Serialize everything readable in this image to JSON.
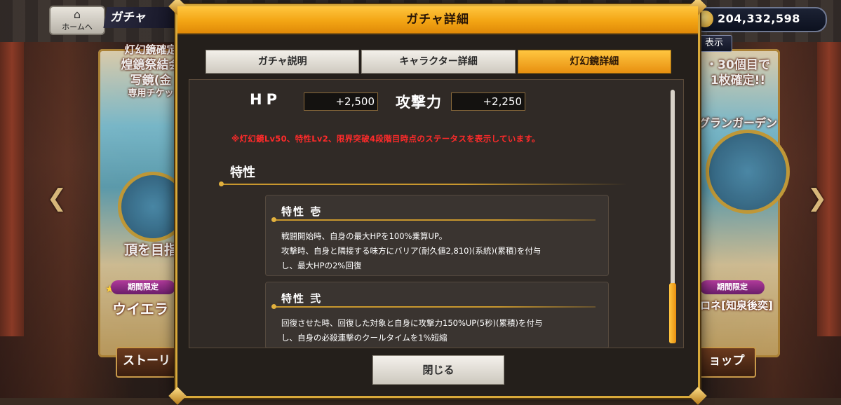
{
  "top_bar": {
    "home_label": "ホームへ",
    "screen_title": "ガチャ",
    "currency_value": "204,332,598",
    "display_label": "表示"
  },
  "background": {
    "left_banner": {
      "line1": "灯幻鏡確定",
      "line2": "煌鏡祭結会",
      "line3": "写鏡(金",
      "line4": "専用チケッ",
      "caption": "頂を目指",
      "limited_tag": "期間限定",
      "char_name": "ウイエラ",
      "bottom_button": "ストーリ"
    },
    "right_banner": {
      "line1": "・30個目で",
      "line2": "1枚確定!!",
      "caption": "グランガーデン",
      "limited_tag": "期間限定",
      "char_name": "ロネ[知泉後奕]",
      "bottom_button": "ョップ"
    }
  },
  "modal": {
    "title": "ガチャ詳細",
    "tabs": [
      {
        "label": "ガチャ説明",
        "active": false
      },
      {
        "label": "キャラクター詳細",
        "active": false
      },
      {
        "label": "灯幻鏡詳細",
        "active": true
      }
    ],
    "stats": {
      "hp_label": "HP",
      "hp_value": "+2,500",
      "atk_label": "攻撃力",
      "atk_value": "+2,250"
    },
    "note": "※灯幻鏡Lv50、特性Lv2、限界突破4段階目時点のステータスを表示しています。",
    "section_title": "特性",
    "traits": [
      {
        "title": "特性 壱",
        "lines": [
          "戦闘開始時、自身の最大HPを100%乗算UP。",
          "攻撃時、自身と隣接する味方にバリア(耐久値2,810)(系統)(累積)を付与",
          "し、最大HPの2%回復"
        ]
      },
      {
        "title": "特性 弐",
        "lines": [
          "回復させた時、回復した対象と自身に攻撃力150%UP(5秒)(累積)を付与",
          "し、自身の必殺連撃のクールタイムを1%短縮"
        ]
      }
    ],
    "close_label": "閉じる"
  },
  "colors": {
    "accent_gold": "#f3a514",
    "note_red": "#ff2a2a",
    "panel_dark": "#241f1b"
  }
}
